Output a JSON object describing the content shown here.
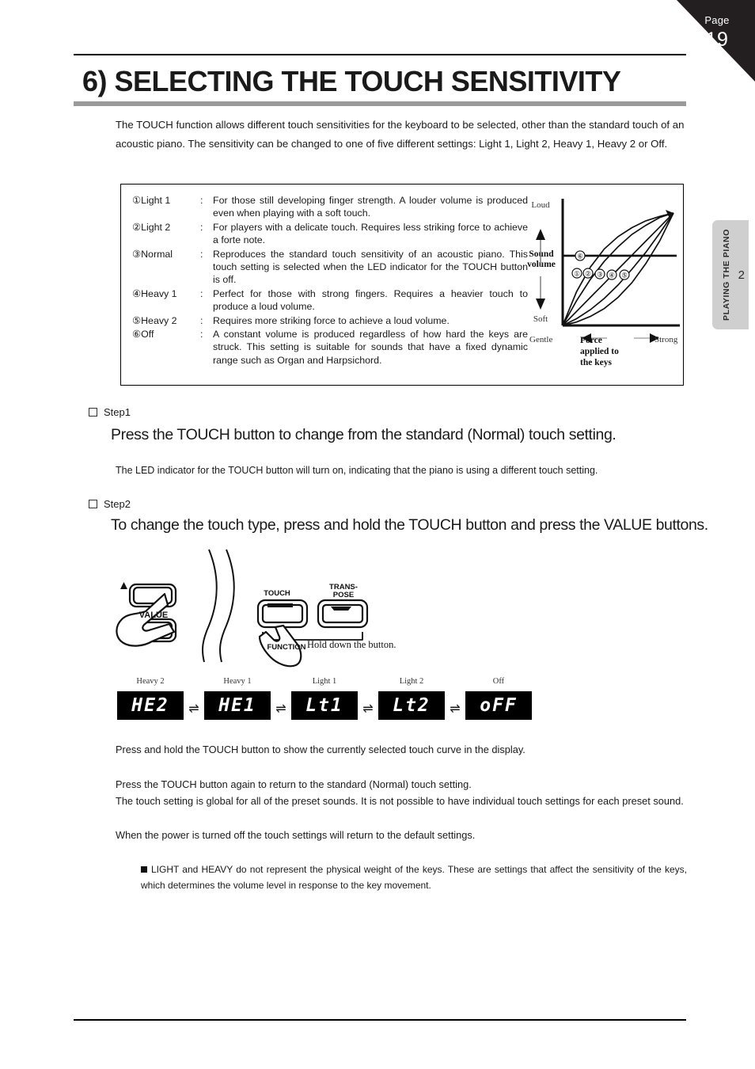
{
  "page": {
    "label": "Page",
    "number": "19",
    "side_tab": {
      "text": "PLAYING THE PIANO",
      "number": "2"
    }
  },
  "title": "6) SELECTING THE TOUCH SENSITIVITY",
  "intro": "The TOUCH function allows different touch sensitivities for the keyboard to be selected, other than the standard touch of an acoustic piano. The sensitivity can be changed to one of five different settings: Light 1, Light 2, Heavy 1, Heavy 2 or Off.",
  "definitions": [
    {
      "num": "①",
      "name": "Light 1",
      "colon": ":",
      "desc": "For those still developing finger strength. A louder volume is produced even when playing with a soft touch."
    },
    {
      "num": "②",
      "name": "Light 2",
      "colon": ":",
      "desc": "For players with a delicate touch. Requires less striking force to achieve a forte note."
    },
    {
      "num": "③",
      "name": "Normal",
      "colon": ":",
      "desc": "Reproduces the standard touch sensitivity of an acoustic piano. This touch setting is selected when the LED indicator for the TOUCH button is off."
    },
    {
      "num": "④",
      "name": "Heavy 1",
      "colon": ":",
      "desc": "Perfect for those with strong fingers. Requires a heavier touch to produce a loud volume."
    },
    {
      "num": "⑤",
      "name": "Heavy 2",
      "colon": ":",
      "desc": "Requires more striking force to achieve a loud volume."
    },
    {
      "num": "⑥",
      "name": "Off",
      "colon": ":",
      "desc": "A constant volume is produced regardless of how hard the keys are struck. This setting is suitable for sounds that have a fixed dynamic range such as Organ and Harpsichord."
    }
  ],
  "chart_data": {
    "type": "line",
    "title": "",
    "xlabel": "Force applied to the keys",
    "ylabel": "Sound volume",
    "x_axis_low_label": "Gentle",
    "x_axis_high_label": "Strong",
    "y_axis_low_label": "Soft",
    "y_axis_high_label": "Loud",
    "x_label_line1": "Force",
    "x_label_line2": "applied to",
    "x_label_line3": "the keys",
    "y_label_line1": "Sound",
    "y_label_line2": "volume",
    "xlim": [
      0,
      1
    ],
    "ylim": [
      0,
      1
    ],
    "grid": false,
    "legend_position": "inline-markers",
    "x": [
      0,
      0.125,
      0.25,
      0.375,
      0.5,
      0.625,
      0.75,
      0.875,
      1
    ],
    "series": [
      {
        "name": "①",
        "label": "Light 1",
        "values": [
          0,
          0.3,
          0.52,
          0.68,
          0.79,
          0.87,
          0.93,
          0.97,
          1.0
        ]
      },
      {
        "name": "②",
        "label": "Light 2",
        "values": [
          0,
          0.22,
          0.41,
          0.57,
          0.7,
          0.81,
          0.89,
          0.96,
          1.0
        ]
      },
      {
        "name": "③",
        "label": "Normal",
        "values": [
          0,
          0.125,
          0.25,
          0.375,
          0.5,
          0.625,
          0.75,
          0.875,
          1.0
        ]
      },
      {
        "name": "④",
        "label": "Heavy 1",
        "values": [
          0,
          0.06,
          0.14,
          0.24,
          0.36,
          0.5,
          0.65,
          0.82,
          1.0
        ]
      },
      {
        "name": "⑤",
        "label": "Heavy 2",
        "values": [
          0,
          0.03,
          0.08,
          0.15,
          0.25,
          0.38,
          0.55,
          0.75,
          1.0
        ]
      },
      {
        "name": "⑥",
        "label": "Off",
        "values": [
          0.62,
          0.62,
          0.62,
          0.62,
          0.62,
          0.62,
          0.62,
          0.62,
          0.62
        ]
      }
    ],
    "markers": [
      "①",
      "②",
      "③",
      "④",
      "⑤",
      "⑥"
    ]
  },
  "step1": {
    "label": "Step1",
    "heading": "Press the TOUCH button to change from the standard (Normal) touch setting.",
    "sub": "The LED indicator for the TOUCH button will turn on, indicating that the piano is using a different touch setting."
  },
  "step2": {
    "label": "Step2",
    "heading": "To change the touch type, press and hold the TOUCH button and press the VALUE buttons."
  },
  "illustration": {
    "value_label": "VALUE",
    "touch_label": "TOUCH",
    "transpose_label_line1": "TRANS-",
    "transpose_label_line2": "POSE",
    "function_label": "FUNCTION",
    "hold_caption": "Hold down the button."
  },
  "led_sequence": {
    "arrow": "⇌",
    "items": [
      {
        "caption": "Heavy 2",
        "display": "HE2"
      },
      {
        "caption": "Heavy 1",
        "display": "HE1"
      },
      {
        "caption": "Light 1",
        "display": "Lt1"
      },
      {
        "caption": "Light 2",
        "display": "Lt2"
      },
      {
        "caption": "Off",
        "display": "oFF"
      }
    ]
  },
  "body": {
    "p1": "Press and hold the TOUCH button to show the currently selected touch curve in the display.",
    "p2": "Press the TOUCH button again to return to the standard (Normal) touch setting.",
    "p3": "The touch setting is global for all of the preset sounds. It is not possible to have individual touch settings for each preset sound.",
    "p4": "When the power is turned off the touch settings will return to the default settings.",
    "note": "LIGHT and HEAVY do not represent the physical weight of the keys. These are settings that affect the sensitivity of the keys, which determines the volume level in response to the key movement."
  }
}
